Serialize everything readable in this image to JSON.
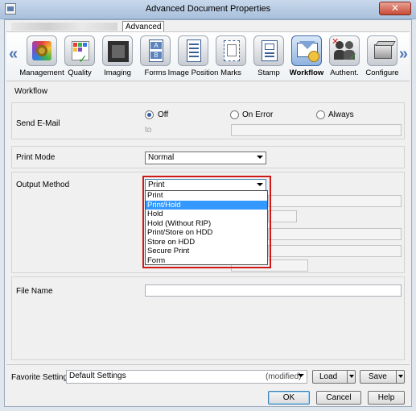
{
  "window": {
    "title": "Advanced Document Properties",
    "close_glyph": "✕"
  },
  "tabs": {
    "active": "Advanced"
  },
  "categories": [
    {
      "label": "Management",
      "icon": "management-gear-icon"
    },
    {
      "label": "Quality",
      "icon": "quality-grid-check-icon"
    },
    {
      "label": "Imaging",
      "icon": "imaging-icon"
    },
    {
      "label": "Forms",
      "icon": "forms-icon"
    },
    {
      "label": "Image Position",
      "icon": "image-position-icon"
    },
    {
      "label": "Marks",
      "icon": "marks-icon"
    },
    {
      "label": "Stamp",
      "icon": "stamp-icon"
    },
    {
      "label": "Workflow",
      "icon": "workflow-mail-icon",
      "active": true
    },
    {
      "label": "Authent.",
      "icon": "authentication-users-icon"
    },
    {
      "label": "Configure",
      "icon": "configure-cube-icon"
    }
  ],
  "nav": {
    "left_glyph": "«",
    "right_glyph": "»"
  },
  "workflow": {
    "section_title": "Workflow",
    "send_email": {
      "label": "Send E-Mail",
      "options": [
        "Off",
        "On Error",
        "Always"
      ],
      "selected": "Off",
      "to_label": "to",
      "to_value": ""
    },
    "print_mode": {
      "label": "Print Mode",
      "value": "Normal"
    },
    "output_method": {
      "label": "Output Method",
      "value": "Print",
      "options": [
        "Print",
        "Print/Hold",
        "Hold",
        "Hold (Without RIP)",
        "Print/Store on HDD",
        "Store on HDD",
        "Secure Print",
        "Form"
      ],
      "highlighted": "Print/Hold"
    },
    "file_name": {
      "label": "File Name",
      "value": ""
    }
  },
  "favorite": {
    "label": "Favorite Setting",
    "value": "Default Settings",
    "status": "(modified)"
  },
  "buttons": {
    "load": "Load",
    "save": "Save",
    "ok": "OK",
    "cancel": "Cancel",
    "help": "Help"
  },
  "colors": {
    "accent": "#4d76b3",
    "selection": "#3399ff",
    "highlight_border": "#d01818"
  }
}
